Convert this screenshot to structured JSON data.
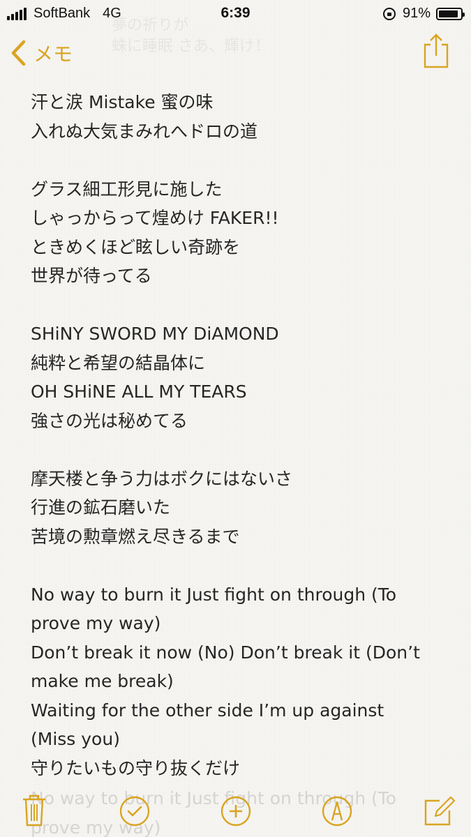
{
  "status_bar": {
    "carrier": "SoftBank",
    "network": "4G",
    "time": "6:39",
    "battery_percent": "91%",
    "battery_level": 0.91
  },
  "nav": {
    "back_label": "メモ",
    "ghost_title_line1": "夢の祈りが",
    "ghost_title_line2": "蛛に睡眠 さあ、輝け！"
  },
  "note": {
    "lines": [
      "汗と涙 Mistake 蜜の味",
      "入れぬ大気まみれへドロの道",
      "",
      "グラス細工形見に施した",
      "しゃっからって煌めけ FAKER!!",
      "ときめくほど眩しい奇跡を",
      "世界が待ってる",
      "",
      "SHiNY SWORD MY DiAMOND",
      "純粋と希望の結晶体に",
      "OH SHiNE ALL MY TEARS",
      "強さの光は秘めてる",
      "",
      "摩天楼と争う力はボクにはないさ",
      "行進の鉱石磨いた",
      "苦境の勲章燃え尽きるまで",
      "",
      "No way to burn it Just fight on through (To",
      "prove my way)",
      "Don’t break it now (No) Don’t break it (Don’t",
      "make me break)",
      "Waiting for the other side I’m up against",
      "(Miss you)",
      "守りたいもの守り抜くだけ"
    ],
    "faded_line1": "No way to burn it Just fight on through (To",
    "faded_line2": "prove my way)"
  },
  "colors": {
    "accent": "#d9a421",
    "text": "#262626",
    "background": "#f6f5f1"
  },
  "toolbar": {
    "icons": [
      "trash-icon",
      "checklist-icon",
      "add-icon",
      "markup-icon",
      "compose-icon"
    ]
  }
}
